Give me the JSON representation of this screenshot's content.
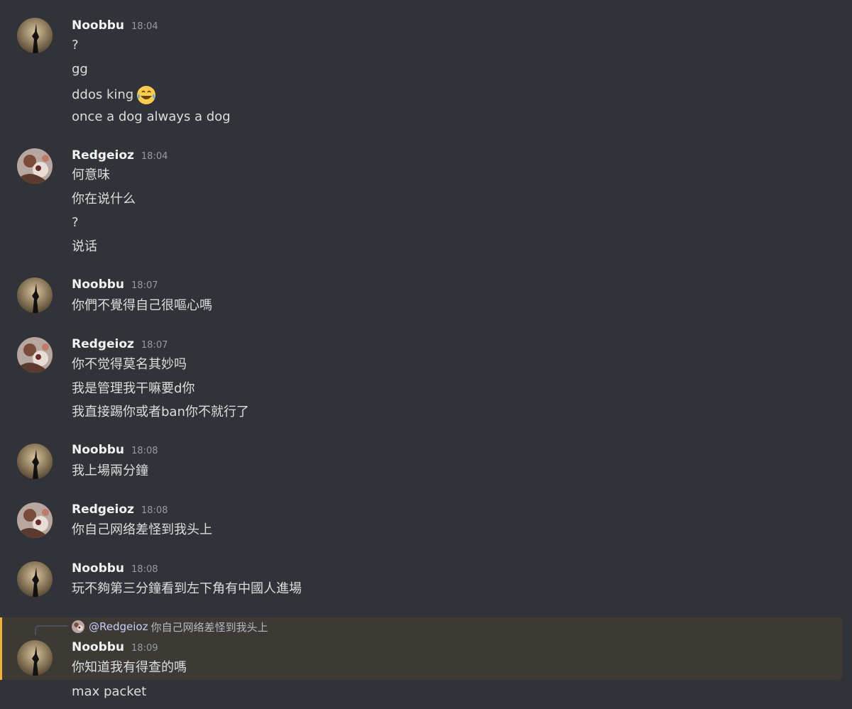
{
  "channel": {
    "messages": [
      {
        "user": "Noobbu",
        "time": "18:04",
        "lines": [
          "?",
          "gg",
          "ddos king",
          "once a dog always a dog"
        ],
        "emoji": {
          "line": 2,
          "icon": "face-with-tears-of-joy-icon"
        }
      },
      {
        "user": "Redgeioz",
        "time": "18:04",
        "lines": [
          "何意味",
          "你在说什么",
          "?",
          "说话"
        ]
      },
      {
        "user": "Noobbu",
        "time": "18:07",
        "lines": [
          "你們不覺得自己很嘔心嗎"
        ]
      },
      {
        "user": "Redgeioz",
        "time": "18:07",
        "lines": [
          "你不觉得莫名其妙吗",
          "我是管理我干嘛要d你",
          "我直接踢你或者ban你不就行了"
        ]
      },
      {
        "user": "Noobbu",
        "time": "18:08",
        "lines": [
          "我上場兩分鐘"
        ]
      },
      {
        "user": "Redgeioz",
        "time": "18:08",
        "lines": [
          "你自己网络差怪到我头上"
        ]
      },
      {
        "user": "Noobbu",
        "time": "18:08",
        "lines": [
          "玩不夠第三分鐘看到左下角有中國人進場"
        ]
      },
      {
        "user": "Noobbu",
        "time": "18:09",
        "lines": [
          "你知道我有得查的嗎",
          "max packet"
        ],
        "reply": {
          "mention": "@Redgeioz",
          "text": "你自己网络差怪到我头上"
        }
      }
    ]
  },
  "colors": {
    "background": "#313338",
    "highlight_bg": "#3d3a35",
    "highlight_bar": "#f0b232",
    "mention": "#c9cdfb"
  }
}
